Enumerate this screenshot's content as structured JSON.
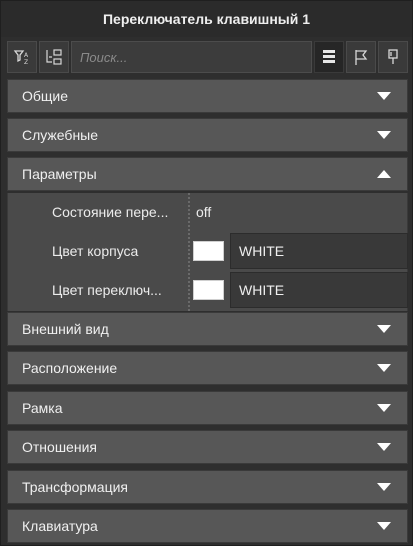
{
  "window": {
    "title": "Переключатель клавишный 1"
  },
  "toolbar": {
    "search_placeholder": "Поиск...",
    "icons": [
      "filter-sort-icon",
      "expand-collapse-icon",
      "list-view-icon",
      "flag-icon",
      "pin-icon"
    ]
  },
  "sections": [
    {
      "label": "Общие",
      "expanded": false
    },
    {
      "label": "Служебные",
      "expanded": false
    },
    {
      "label": "Параметры",
      "expanded": true
    },
    {
      "label": "Внешний вид",
      "expanded": false
    },
    {
      "label": "Расположение",
      "expanded": false
    },
    {
      "label": "Рамка",
      "expanded": false
    },
    {
      "label": "Отношения",
      "expanded": false
    },
    {
      "label": "Трансформация",
      "expanded": false
    },
    {
      "label": "Клавиатура",
      "expanded": false
    }
  ],
  "parameters": {
    "state": {
      "label": "Состояние пере...",
      "value": "off"
    },
    "body_color": {
      "label": "Цвет корпуса",
      "value": "WHITE",
      "swatch": "#ffffff"
    },
    "switch_color": {
      "label": "Цвет переключ...",
      "value": "WHITE",
      "swatch": "#ffffff"
    }
  }
}
